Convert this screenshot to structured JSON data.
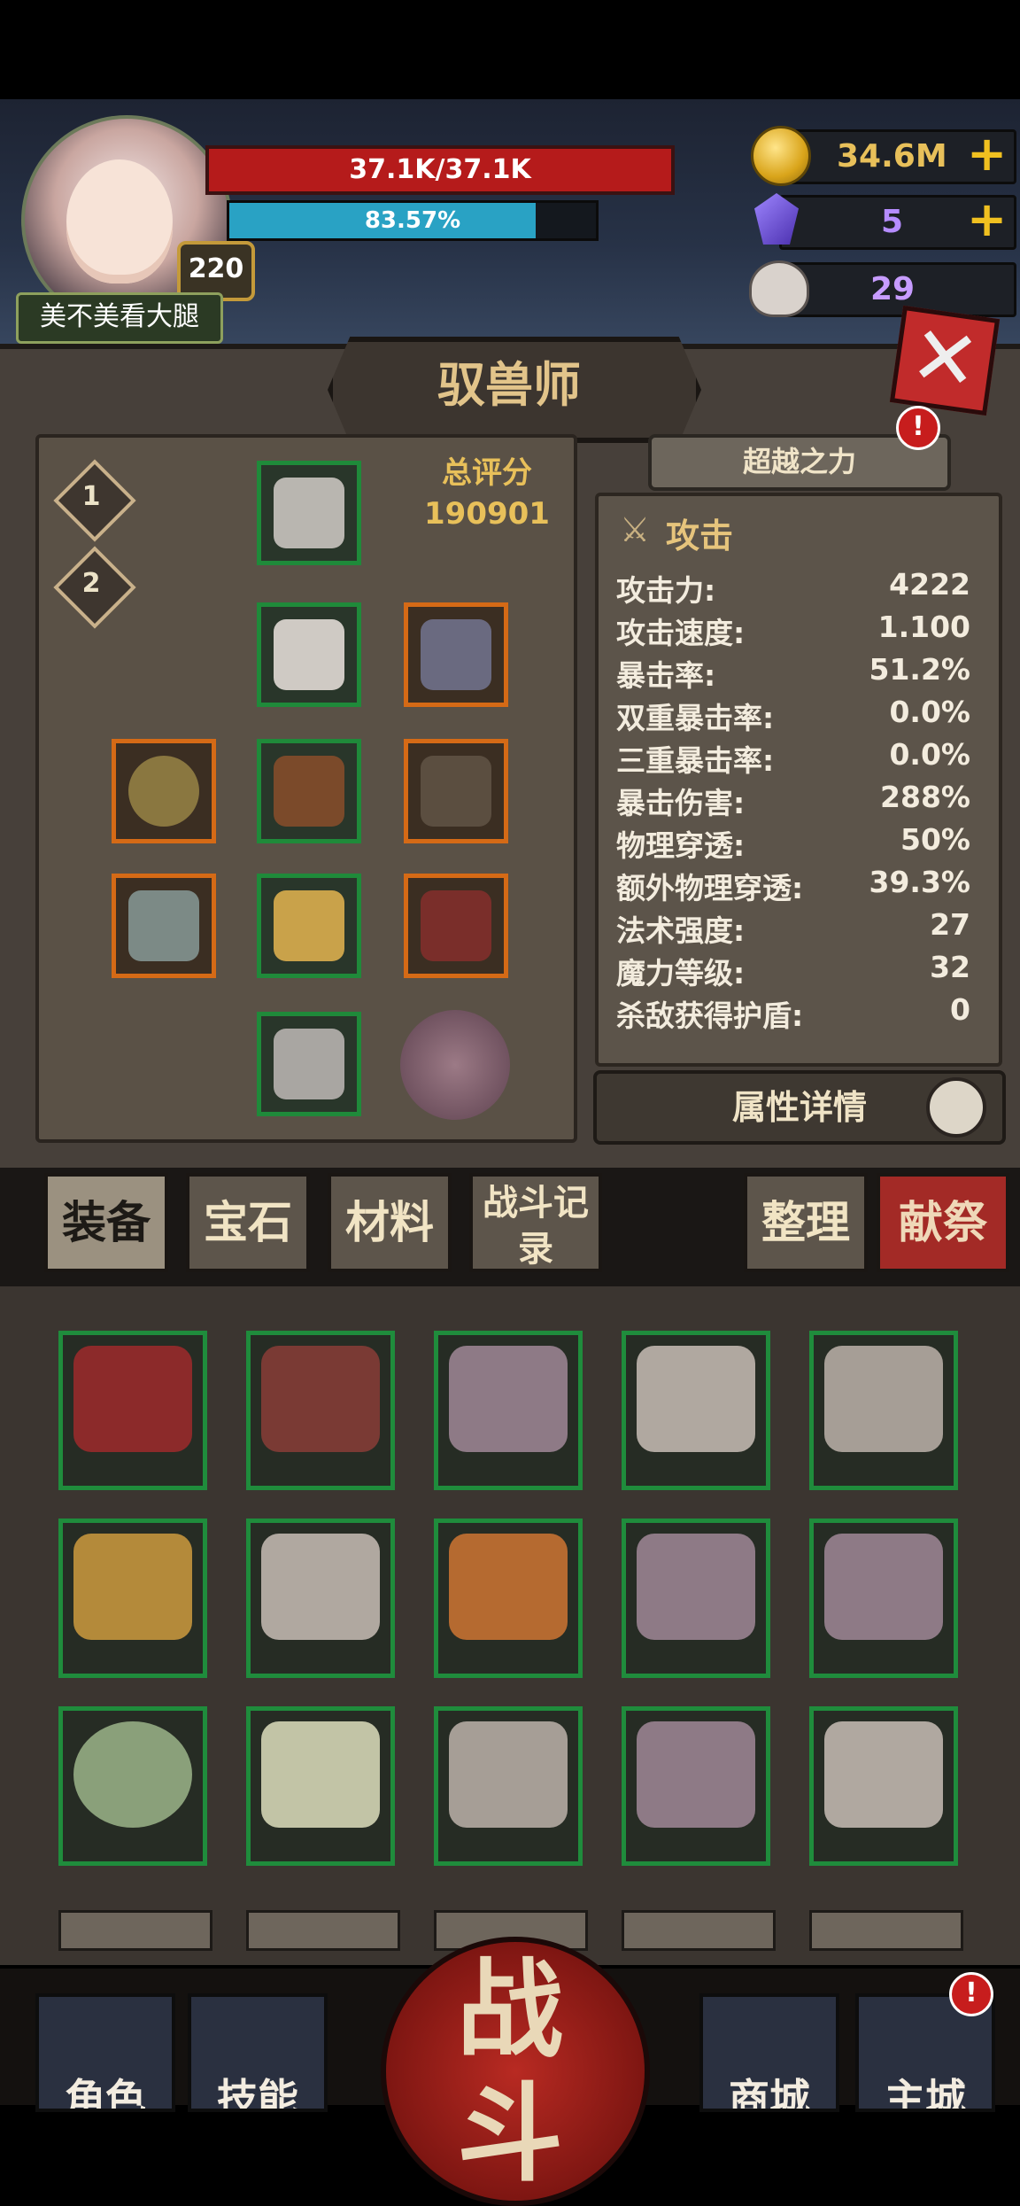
{
  "player": {
    "name": "美不美看大腿",
    "level": "220",
    "hp_text": "37.1K/37.1K",
    "xp_text": "83.57%",
    "xp_fraction": 0.8357
  },
  "currencies": {
    "gold": "34.6M",
    "gems": "5",
    "souls": "29",
    "plus": "+"
  },
  "page": {
    "title": "驭兽师",
    "close_symbol": "✕"
  },
  "equipment": {
    "loadouts": [
      "1",
      "2"
    ],
    "score_label": "总评分",
    "score_value": "190901",
    "surpass_label": "超越之力",
    "alert_mark": "!"
  },
  "stats": {
    "header": "攻击",
    "rows": [
      {
        "label": "攻击力:",
        "value": "4222"
      },
      {
        "label": "攻击速度:",
        "value": "1.100"
      },
      {
        "label": "暴击率:",
        "value": "51.2%"
      },
      {
        "label": "双重暴击率:",
        "value": "0.0%"
      },
      {
        "label": "三重暴击率:",
        "value": "0.0%"
      },
      {
        "label": "暴击伤害:",
        "value": "288%"
      },
      {
        "label": "物理穿透:",
        "value": "50%"
      },
      {
        "label": "额外物理穿透:",
        "value": "39.3%"
      },
      {
        "label": "法术强度:",
        "value": "27"
      },
      {
        "label": "魔力等级:",
        "value": "32"
      },
      {
        "label": "杀敌获得护盾:",
        "value": "0"
      }
    ],
    "details_label": "属性详情"
  },
  "tabs": {
    "equipment": "装备",
    "gems": "宝石",
    "materials": "材料",
    "battle_log": "战斗记录",
    "sort": "整理",
    "sacrifice": "献祭"
  },
  "nav": {
    "character": "角色",
    "skills": "技能",
    "battle": "战斗",
    "shop": "商城",
    "main_city": "主城"
  },
  "colors": {
    "hp": "#b51b1b",
    "xp": "#29a2c4",
    "gold": "#e8c05a",
    "slot_green": "#1f8a3a",
    "slot_orange": "#d56a16"
  }
}
